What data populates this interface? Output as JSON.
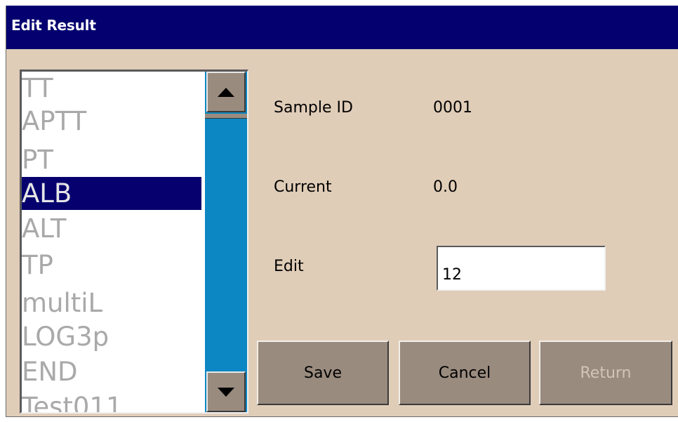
{
  "window": {
    "title": "Edit Result"
  },
  "list": {
    "items": [
      "TT",
      "APTT",
      "PT",
      "ALB",
      "ALT",
      "TP",
      "multiL",
      "LOG3p",
      "END",
      "Test011"
    ],
    "selected_index": 3
  },
  "fields": {
    "sample_id_label": "Sample ID",
    "sample_id_value": "0001",
    "current_label": "Current",
    "current_value": "0.0",
    "edit_label": "Edit",
    "edit_value": "12"
  },
  "buttons": {
    "save": "Save",
    "cancel": "Cancel",
    "return": "Return"
  },
  "colors": {
    "titlebar": "#04006f",
    "background": "#e0cdb8",
    "selection": "#06006e",
    "scrollbar_track": "#0d87c3",
    "button_face": "#9a8b7f"
  },
  "icons": {
    "scroll_up": "triangle-up-icon",
    "scroll_down": "triangle-down-icon"
  }
}
